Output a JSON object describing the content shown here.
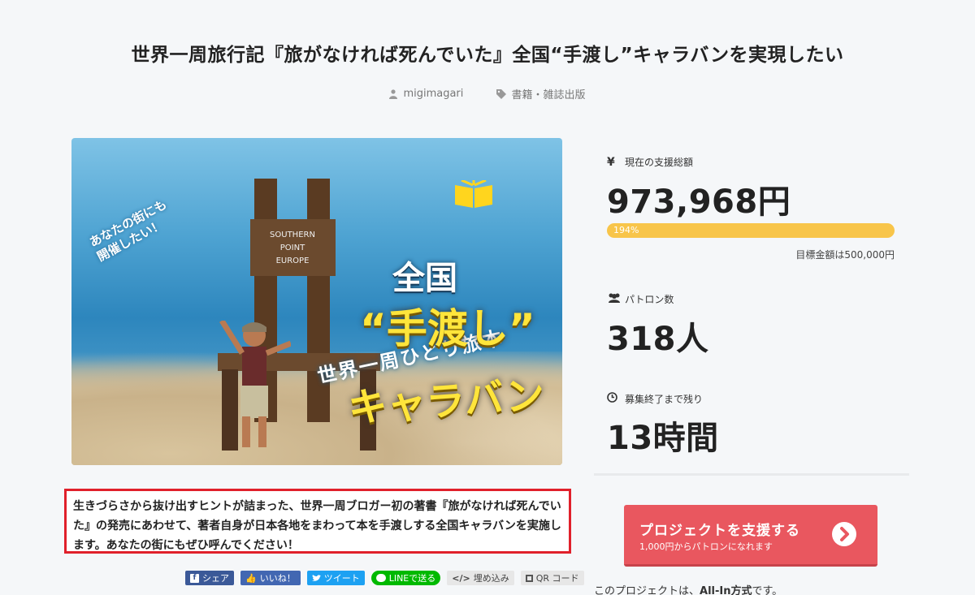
{
  "project": {
    "title": "世界一周旅行記『旅がなければ死んでいた』全国“手渡し”キャラバンを実現したい",
    "author": "migimagari",
    "category": "書籍・雑誌出版",
    "description": "生きづらさから抜け出すヒントが詰まった、世界一周ブロガー初の著書『旅がなければ死んでいた』の発売にあわせて、著者自身が日本各地をまわって本を手渡しする全国キャラバンを実施します。あなたの街にもぜひ呼んでください！"
  },
  "hero_image": {
    "sign_text": [
      "SOUTHERN",
      "POINT",
      "EUROPE"
    ],
    "side_text": [
      "あなたの街にも",
      "開催したい！"
    ],
    "subtitle": "世界一周ひとり旅本",
    "line1": "全国",
    "line2": "“手渡し”",
    "line3": "キャラバン"
  },
  "share": {
    "facebook": "シェア",
    "like": "いいね！",
    "tweet": "ツイート",
    "line": "LINEで送る",
    "embed": "埋め込み",
    "qr": "QR コード"
  },
  "stats": {
    "total_label": "現在の支援総額",
    "total_icon": "¥",
    "total_amount": "973,968円",
    "progress_percent": 194,
    "progress_label": "194%",
    "goal": "目標金額は500,000円",
    "backers_label": "パトロン数",
    "backers": "318人",
    "remaining_label": "募集終了まで残り",
    "remaining": "13時間"
  },
  "cta": {
    "label": "プロジェクトを支援する",
    "sublabel": "1,000円からパトロンになれます"
  },
  "footer": {
    "allin_prefix": "このプロジェクトは、",
    "allin_bold": "All-In方式",
    "allin_suffix": "です。"
  },
  "colors": {
    "accent": "#e9575f",
    "progress": "#f8c54a",
    "highlight_border": "#e0202b"
  }
}
